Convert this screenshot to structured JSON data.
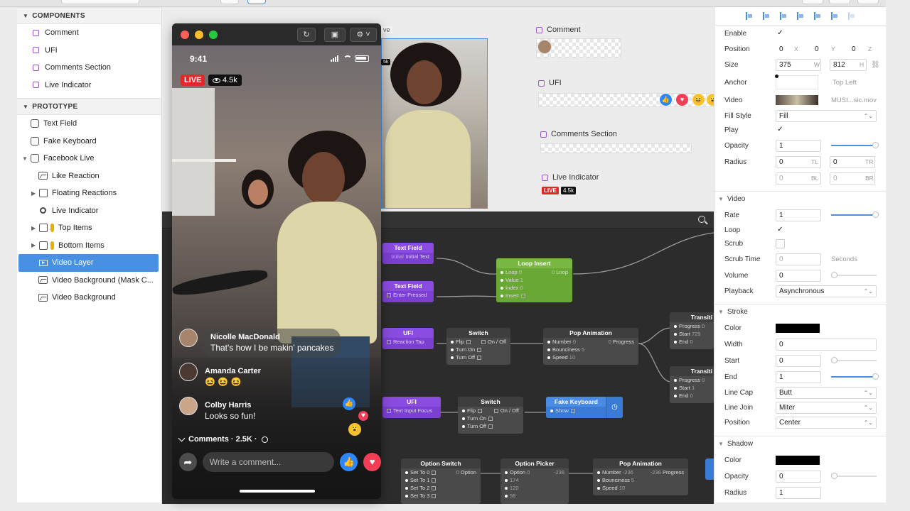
{
  "left_panel": {
    "components_header": "COMPONENTS",
    "components": [
      {
        "label": "Comment"
      },
      {
        "label": "UFI"
      },
      {
        "label": "Comments Section"
      },
      {
        "label": "Live Indicator"
      }
    ],
    "prototype_header": "PROTOTYPE",
    "prototype": [
      {
        "label": "Text Field",
        "icon": "layer-icon"
      },
      {
        "label": "Fake Keyboard",
        "icon": "layer-icon"
      },
      {
        "label": "Facebook Live",
        "icon": "layer-icon"
      },
      {
        "label": "Like Reaction",
        "icon": "image-icon"
      },
      {
        "label": "Floating Reactions",
        "icon": "group-icon"
      },
      {
        "label": "Live Indicator",
        "icon": "ring-icon"
      },
      {
        "label": "Top Items",
        "icon": "group-icon"
      },
      {
        "label": "Bottom Items",
        "icon": "group-icon"
      },
      {
        "label": "Video Layer",
        "icon": "video-icon",
        "selected": true
      },
      {
        "label": "Video Background (Mask C...",
        "icon": "image-icon"
      },
      {
        "label": "Video Background",
        "icon": "image-icon"
      }
    ]
  },
  "phone": {
    "time": "9:41",
    "live_label": "LIVE",
    "views": "4.5k",
    "comments": [
      {
        "name": "Nicolle MacDonald",
        "text": "That's how I be makin' pancakes"
      },
      {
        "name": "Amanda Carter",
        "text": "😆 😆 😆"
      },
      {
        "name": "Colby Harris",
        "text": "Looks so fun!"
      }
    ],
    "comments_count": "Comments · 2.5K ·",
    "write_placeholder": "Write a comment..."
  },
  "canvas": {
    "preview_label": "ve",
    "preview_badge": "5k",
    "component_cards": [
      {
        "title": "Comment"
      },
      {
        "title": "UFI"
      },
      {
        "title": "Comments Section"
      },
      {
        "title": "Live Indicator"
      }
    ],
    "mini_live": "LIVE",
    "mini_views": "4.5k"
  },
  "nodes": {
    "text_field_1": {
      "title": "Text Field",
      "rows": [
        "Initial Text"
      ]
    },
    "text_field_2": {
      "title": "Text Field",
      "rows": [
        "Enter Pressed"
      ]
    },
    "loop_insert": {
      "title": "Loop Insert",
      "rows": [
        [
          "Loop",
          "0",
          "0",
          "Loop"
        ],
        [
          "Value",
          "1"
        ],
        [
          "Index",
          "0"
        ],
        [
          "Insert",
          ""
        ]
      ]
    },
    "ufi_1": {
      "title": "UFI",
      "rows": [
        "Reaction Tap"
      ]
    },
    "switch_1": {
      "title": "Switch",
      "rows": [
        "Flip",
        "On / Off",
        "Turn On",
        "Turn Off"
      ]
    },
    "pop_anim_1": {
      "title": "Pop Animation",
      "rows": [
        [
          "Number",
          "0",
          "0",
          "Progress"
        ],
        [
          "Bounciness",
          "5"
        ],
        [
          "Speed",
          "10"
        ]
      ]
    },
    "transit_1": {
      "title": "Transiti",
      "rows": [
        [
          "Progress",
          "0"
        ],
        [
          "Start",
          "729"
        ],
        [
          "End",
          "0"
        ]
      ]
    },
    "transit_2": {
      "title": "Transiti",
      "rows": [
        [
          "Progress",
          "0"
        ],
        [
          "Start",
          "1"
        ],
        [
          "End",
          "0"
        ]
      ]
    },
    "ufi_2": {
      "title": "UFI",
      "rows": [
        "Text Input Focus"
      ]
    },
    "switch_2": {
      "title": "Switch",
      "rows": [
        "Flip",
        "On / Off",
        "Turn On",
        "Turn Off"
      ]
    },
    "fake_keyboard": {
      "title": "Fake Keyboard",
      "rows": [
        "Show"
      ]
    },
    "option_switch": {
      "title": "Option Switch",
      "rows": [
        [
          "Set To 0",
          "0",
          "Option"
        ],
        [
          "Set To 1"
        ],
        [
          "Set To 2"
        ],
        [
          "Set To 3"
        ]
      ]
    },
    "option_picker": {
      "title": "Option Picker",
      "rows": [
        [
          "Option",
          "0",
          "-236"
        ],
        [
          "174"
        ],
        [
          "120"
        ],
        [
          "58"
        ]
      ]
    },
    "pop_anim_2": {
      "title": "Pop Animation",
      "rows": [
        [
          "Number",
          "-236",
          "-236",
          "Progress"
        ],
        [
          "Bounciness",
          "5"
        ],
        [
          "Speed",
          "10"
        ]
      ]
    }
  },
  "inspector": {
    "enable_label": "Enable",
    "position_label": "Position",
    "position": {
      "x": "0",
      "y": "0",
      "z": "0"
    },
    "size_label": "Size",
    "size": {
      "w": "375",
      "h": "812"
    },
    "anchor_label": "Anchor",
    "anchor_value": "Top Left",
    "video_label": "Video",
    "video_file": "MUSI...sic.mov",
    "fill_style_label": "Fill Style",
    "fill_style": "Fill",
    "play_label": "Play",
    "opacity_label": "Opacity",
    "opacity": "1",
    "radius_label": "Radius",
    "radius": {
      "tl": "0",
      "tr": "0",
      "bl": "0",
      "br": "0"
    },
    "video_section": "Video",
    "rate_label": "Rate",
    "rate": "1",
    "loop_label": "Loop",
    "scrub_label": "Scrub",
    "scrub_time_label": "Scrub Time",
    "scrub_time": "0",
    "seconds_unit": "Seconds",
    "volume_label": "Volume",
    "volume": "0",
    "playback_label": "Playback",
    "playback": "Asynchronous",
    "stroke_section": "Stroke",
    "color_label": "Color",
    "width_label": "Width",
    "width": "0",
    "start_label": "Start",
    "start": "0",
    "end_label": "End",
    "end": "1",
    "line_cap_label": "Line Cap",
    "line_cap": "Butt",
    "line_join_label": "Line Join",
    "line_join": "Miter",
    "stroke_position_label": "Position",
    "stroke_position": "Center",
    "shadow_section": "Shadow",
    "shadow_color_label": "Color",
    "shadow_opacity_label": "Opacity",
    "shadow_opacity": "0",
    "shadow_radius_label": "Radius",
    "shadow_radius": "1",
    "unit_x": "X",
    "unit_y": "Y",
    "unit_z": "Z",
    "unit_w": "W",
    "unit_h": "H",
    "unit_tl": "TL",
    "unit_tr": "TR",
    "unit_bl": "BL",
    "unit_br": "BR"
  },
  "colors": {
    "accent": "#4a90e2",
    "live_red": "#e02a2a",
    "node_purple": "#7b3fd1",
    "node_green": "#6aa836",
    "node_blue": "#3a7bd5"
  }
}
